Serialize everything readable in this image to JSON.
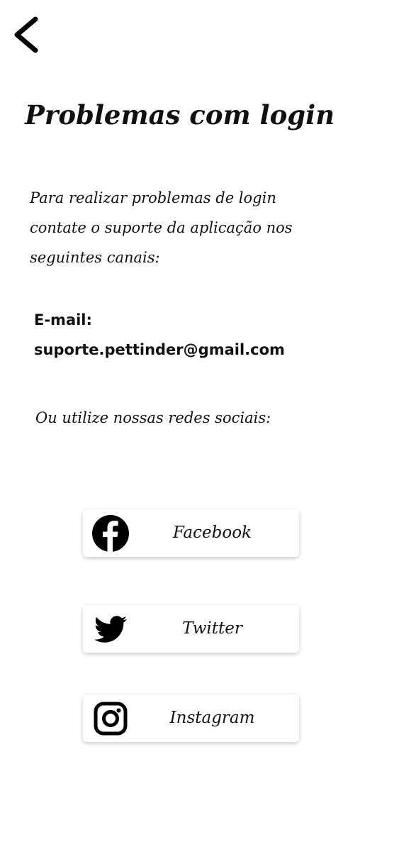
{
  "header": {
    "back_icon": "chevron-left-icon",
    "title": "Problemas com login"
  },
  "content": {
    "intro_lines": [
      "Para realizar problemas de login",
      "contate o suporte da aplicação nos",
      "seguintes canais:"
    ],
    "email_label": "E-mail:",
    "email_address": "suporte.pettinder@gmail.com",
    "social_intro": "Ou utilize nossas redes sociais:"
  },
  "social_buttons": [
    {
      "label": "Facebook",
      "icon": "facebook-icon"
    },
    {
      "label": "Twitter",
      "icon": "twitter-icon"
    },
    {
      "label": "Instagram",
      "icon": "instagram-icon"
    }
  ],
  "colors": {
    "text": "#111111",
    "background": "#ffffff",
    "button_background": "#ffffff"
  }
}
